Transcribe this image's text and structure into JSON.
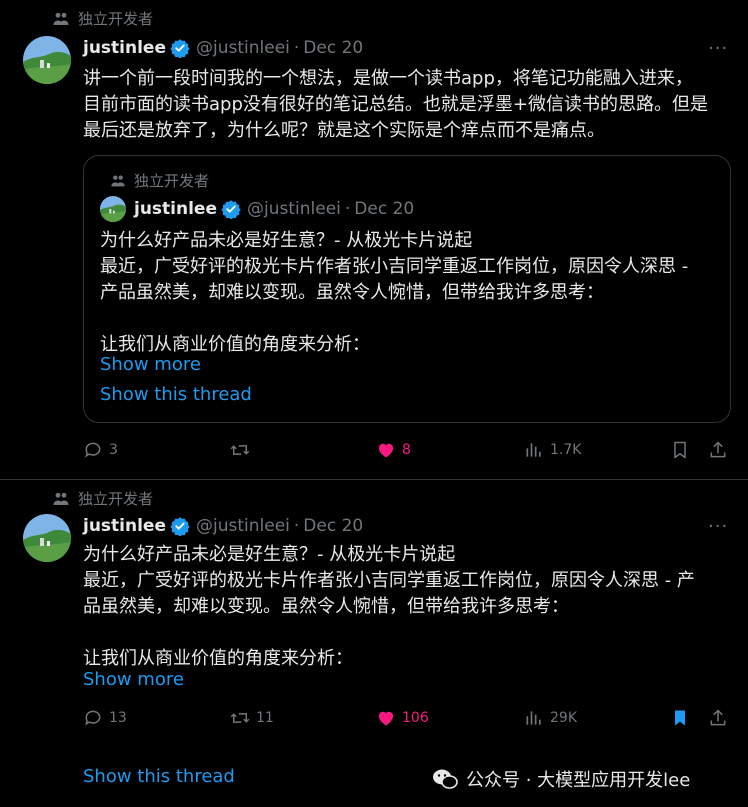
{
  "tweet1": {
    "social_context": "独立开发者",
    "name": "justinlee",
    "handle": "@justinleei",
    "date": "Dec 20",
    "more": "···",
    "text_lines": [
      "讲一个前一段时间我的一个想法，是做一个读书app，将笔记功能融入进来，",
      "目前市面的读书app没有很好的笔记总结。也就是浮墨+微信读书的思路。但是",
      "最后还是放弃了，为什么呢？就是这个实际是个痒点而不是痛点。"
    ],
    "quote": {
      "social_context": "独立开发者",
      "name": "justinlee",
      "handle": "@justinleei",
      "date": "Dec 20",
      "text_lines": [
        "为什么好产品未必是好生意？- 从极光卡片说起",
        "最近，广受好评的极光卡片作者张小吉同学重返工作岗位，原因令人深思 -",
        "产品虽然美，却难以变现。虽然令人惋惜，但带给我许多思考：",
        "",
        "让我们从商业价值的角度来分析："
      ],
      "show_more": "Show more",
      "show_thread": "Show this thread"
    },
    "actions": {
      "replies": "3",
      "retweets": "",
      "likes": "8",
      "views": "1.7K"
    }
  },
  "tweet2": {
    "social_context": "独立开发者",
    "name": "justinlee",
    "handle": "@justinleei",
    "date": "Dec 20",
    "more": "···",
    "text_lines": [
      "为什么好产品未必是好生意？- 从极光卡片说起",
      "最近，广受好评的极光卡片作者张小吉同学重返工作岗位，原因令人深思 - 产",
      "品虽然美，却难以变现。虽然令人惋惜，但带给我许多思考：",
      "",
      "让我们从商业价值的角度来分析："
    ],
    "show_more": "Show more",
    "actions": {
      "replies": "13",
      "retweets": "11",
      "likes": "106",
      "views": "29K"
    },
    "show_thread": "Show this thread"
  },
  "watermark": "公众号 · 大模型应用开发lee",
  "colors": {
    "accent": "#1d9bf0",
    "like": "#f91880",
    "muted": "#71767b",
    "text": "#e7e9ea",
    "border": "#2f3336"
  }
}
